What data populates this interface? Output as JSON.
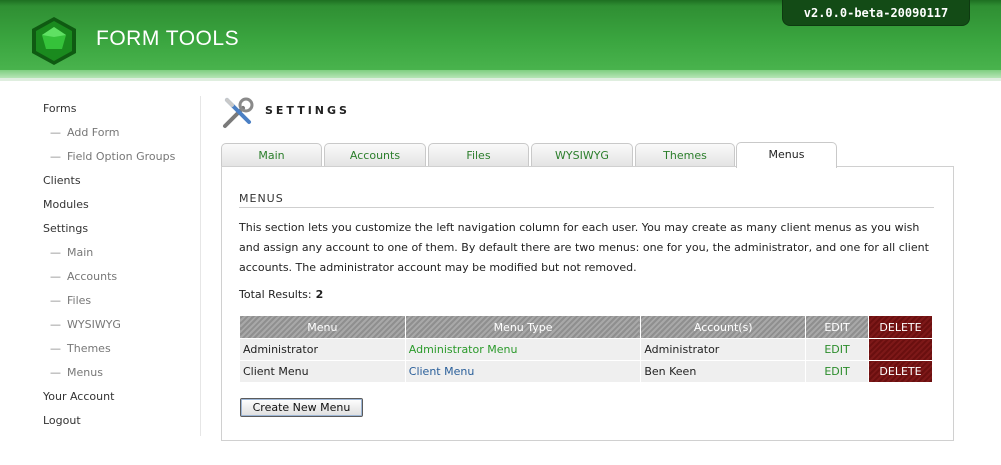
{
  "header": {
    "app_title": "FORM TOOLS",
    "version": "v2.0.0-beta-20090117"
  },
  "nav": {
    "items": [
      {
        "label": "Forms",
        "type": "main"
      },
      {
        "label": "Add Form",
        "type": "sub"
      },
      {
        "label": "Field Option Groups",
        "type": "sub"
      },
      {
        "label": "Clients",
        "type": "main"
      },
      {
        "label": "Modules",
        "type": "main"
      },
      {
        "label": "Settings",
        "type": "main"
      },
      {
        "label": "Main",
        "type": "sub"
      },
      {
        "label": "Accounts",
        "type": "sub"
      },
      {
        "label": "Files",
        "type": "sub"
      },
      {
        "label": "WYSIWYG",
        "type": "sub"
      },
      {
        "label": "Themes",
        "type": "sub"
      },
      {
        "label": "Menus",
        "type": "sub"
      },
      {
        "label": "Your Account",
        "type": "main"
      },
      {
        "label": "Logout",
        "type": "main"
      }
    ],
    "sub_prefix": "—"
  },
  "page": {
    "title": "SETTINGS"
  },
  "tabs": [
    {
      "label": "Main",
      "active": false
    },
    {
      "label": "Accounts",
      "active": false
    },
    {
      "label": "Files",
      "active": false
    },
    {
      "label": "WYSIWYG",
      "active": false
    },
    {
      "label": "Themes",
      "active": false
    },
    {
      "label": "Menus",
      "active": true
    }
  ],
  "section": {
    "title": "MENUS",
    "description": "This section lets you customize the left navigation column for each user. You may create as many client menus as you wish and assign any account to one of them. By default there are two menus: one for you, the administrator, and one for all client accounts. The administrator account may be modified but not removed.",
    "total_label": "Total Results:",
    "total_value": "2"
  },
  "table": {
    "headers": [
      "Menu",
      "Menu Type",
      "Account(s)",
      "EDIT",
      "DELETE"
    ],
    "rows": [
      {
        "menu": "Administrator",
        "menu_type": "Administrator Menu",
        "accounts": "Administrator",
        "edit": "EDIT",
        "delete": ""
      },
      {
        "menu": "Client Menu",
        "menu_type": "Client Menu",
        "accounts": "Ben Keen",
        "edit": "EDIT",
        "delete": "DELETE"
      }
    ]
  },
  "buttons": {
    "create_new_menu": "Create New Menu"
  },
  "colors": {
    "header_green": "#3aa53f",
    "version_bg": "#134b16",
    "link_green": "#2b9a2b",
    "link_blue": "#2a5f9a",
    "delete_red": "#7d1818"
  },
  "icons": {
    "logo": "form-tools-logo",
    "settings": "wrench-screwdriver-icon"
  }
}
